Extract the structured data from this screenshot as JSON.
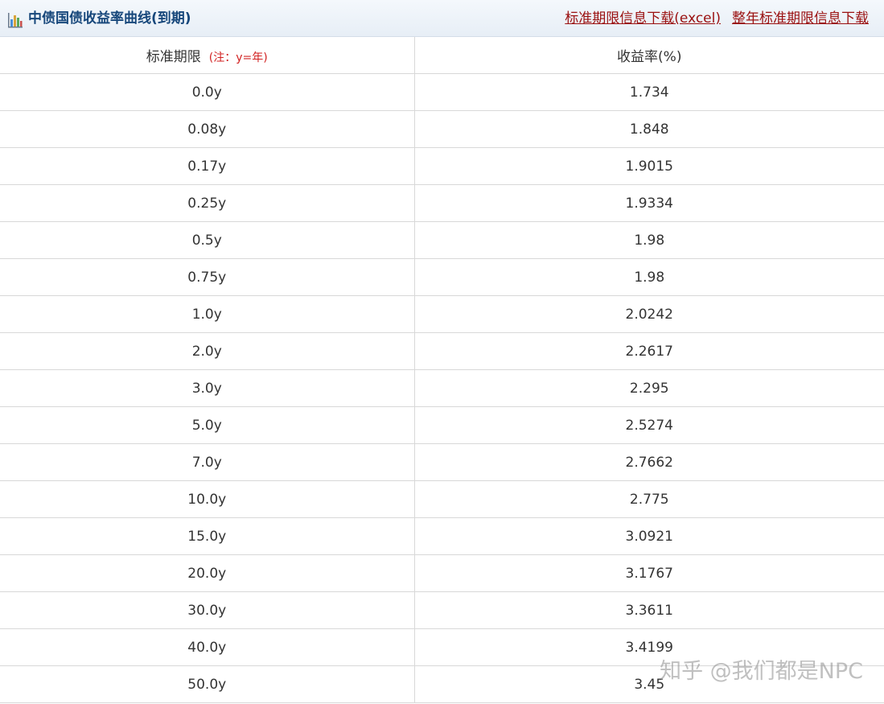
{
  "header": {
    "title": "中债国债收益率曲线(到期)",
    "icon": "bar-chart-icon",
    "links": [
      {
        "label": "标准期限信息下载(excel)"
      },
      {
        "label": "整年标准期限信息下载"
      }
    ],
    "link_color": "#9a1010",
    "title_color": "#17477b"
  },
  "table": {
    "columns": {
      "term": "标准期限",
      "term_note": "(注：y=年)",
      "yield": "收益率(%)"
    },
    "rows": [
      {
        "term": "0.0y",
        "yield": "1.734"
      },
      {
        "term": "0.08y",
        "yield": "1.848"
      },
      {
        "term": "0.17y",
        "yield": "1.9015"
      },
      {
        "term": "0.25y",
        "yield": "1.9334"
      },
      {
        "term": "0.5y",
        "yield": "1.98"
      },
      {
        "term": "0.75y",
        "yield": "1.98"
      },
      {
        "term": "1.0y",
        "yield": "2.0242"
      },
      {
        "term": "2.0y",
        "yield": "2.2617"
      },
      {
        "term": "3.0y",
        "yield": "2.295"
      },
      {
        "term": "5.0y",
        "yield": "2.5274"
      },
      {
        "term": "7.0y",
        "yield": "2.7662"
      },
      {
        "term": "10.0y",
        "yield": "2.775"
      },
      {
        "term": "15.0y",
        "yield": "3.0921"
      },
      {
        "term": "20.0y",
        "yield": "3.1767"
      },
      {
        "term": "30.0y",
        "yield": "3.3611"
      },
      {
        "term": "40.0y",
        "yield": "3.4199"
      },
      {
        "term": "50.0y",
        "yield": "3.45"
      }
    ]
  },
  "watermark": {
    "text": "知乎 @我们都是NPC"
  }
}
